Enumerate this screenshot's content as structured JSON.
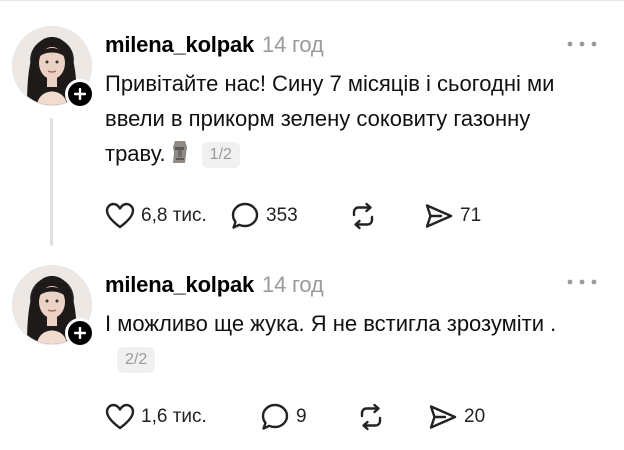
{
  "posts": [
    {
      "username": "milena_kolpak",
      "time": "14 год",
      "text": "Привітайте нас! Сину 7 місяців і сьогодні ми ввели в прикорм зелену соковиту газонну траву.",
      "emoji": "moai-icon",
      "pager": "1/2",
      "likes": "6,8 тис.",
      "replies": "353",
      "reposts": "",
      "shares": "71"
    },
    {
      "username": "milena_kolpak",
      "time": "14 год",
      "text": "І можливо ще жука. Я не встигла зрозуміти .",
      "pager": "2/2",
      "likes": "1,6 тис.",
      "replies": "9",
      "reposts": "",
      "shares": "20"
    }
  ],
  "icons": {
    "like": "heart-icon",
    "reply": "comment-bubble-icon",
    "repost": "repost-arrows-icon",
    "share": "send-icon",
    "more": "more-dots-icon",
    "follow": "plus-icon"
  }
}
